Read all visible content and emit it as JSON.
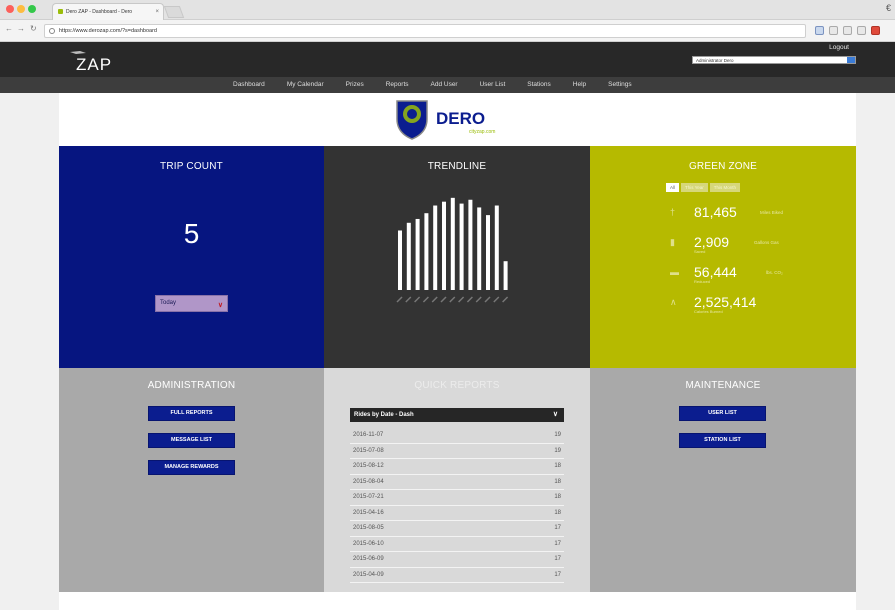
{
  "browser": {
    "tab_title": "Dero ZAP - Dashboard - Dero",
    "tab_close": "×",
    "url": "https://www.derozap.com/?s=dashboard",
    "extra": "€"
  },
  "header": {
    "logo_text": "ZAP",
    "logout_label": "Logout",
    "user_select": "Administrator Dero"
  },
  "nav": {
    "items": [
      "Dashboard",
      "My Calendar",
      "Prizes",
      "Reports",
      "Add User",
      "User List",
      "Stations",
      "Help",
      "Settings"
    ]
  },
  "brand": {
    "logo_text": "DERO",
    "tagline": "cityzap.com"
  },
  "trip_count": {
    "title": "TRIP COUNT",
    "value": "5",
    "period": "Today"
  },
  "trendline": {
    "title": "TRENDLINE",
    "bar_levels": [
      0.62,
      0.7,
      0.74,
      0.8,
      0.88,
      0.92,
      0.96,
      0.9,
      0.94,
      0.86,
      0.78,
      0.88,
      0.3
    ]
  },
  "green_zone": {
    "title": "GREEN ZONE",
    "tabs": [
      "All",
      "This Year",
      "This Month"
    ],
    "stats": [
      {
        "icon": "bike-icon",
        "value": "81,465",
        "unit": "Miles Biked",
        "sub": ""
      },
      {
        "icon": "fuel-icon",
        "value": "2,909",
        "unit": "Gallons Gas",
        "sub": "Saved"
      },
      {
        "icon": "cloud-icon",
        "value": "56,444",
        "unit": "lbs. CO₂",
        "sub": "Reduced"
      },
      {
        "icon": "flame-icon",
        "value": "2,525,414",
        "unit": "",
        "sub": "Calories Burned"
      }
    ]
  },
  "administration": {
    "title": "ADMINISTRATION",
    "buttons": [
      "FULL REPORTS",
      "MESSAGE LIST",
      "MANAGE REWARDS"
    ]
  },
  "quick_reports": {
    "title": "QUICK REPORTS",
    "selected": "Rides by Date - Dash",
    "rows": [
      {
        "date": "2016-11-07",
        "count": "19"
      },
      {
        "date": "2015-07-08",
        "count": "19"
      },
      {
        "date": "2015-08-12",
        "count": "18"
      },
      {
        "date": "2015-08-04",
        "count": "18"
      },
      {
        "date": "2015-07-21",
        "count": "18"
      },
      {
        "date": "2015-04-16",
        "count": "18"
      },
      {
        "date": "2015-08-05",
        "count": "17"
      },
      {
        "date": "2015-06-10",
        "count": "17"
      },
      {
        "date": "2015-06-09",
        "count": "17"
      },
      {
        "date": "2015-04-09",
        "count": "17"
      }
    ]
  },
  "maintenance": {
    "title": "MAINTENANCE",
    "buttons": [
      "USER LIST",
      "STATION LIST"
    ]
  },
  "colors": {
    "trip_bg": "#061580",
    "trend_bg": "#333333",
    "green_bg": "#b6ba00",
    "gray_panel": "#a9a9a9",
    "button_blue": "#0b1d8f"
  }
}
